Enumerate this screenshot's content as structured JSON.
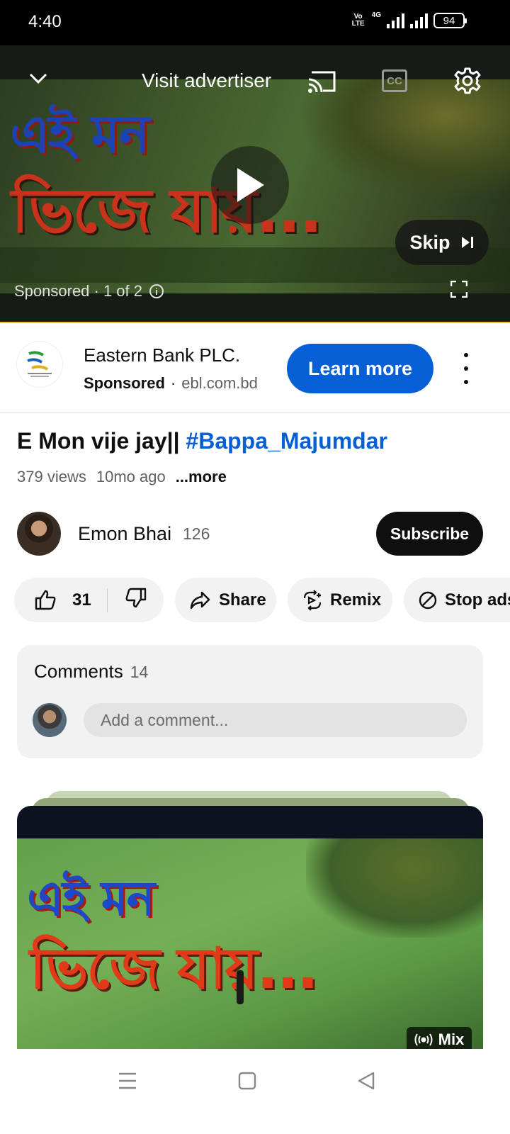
{
  "status_bar": {
    "time": "4:40",
    "volte": "Vo LTE",
    "network": "4G",
    "battery": "94"
  },
  "player": {
    "visit_advertiser": "Visit advertiser",
    "cc_label": "CC",
    "skip_label": "Skip",
    "sponsored_text": "Sponsored · 1 of 2",
    "thumbnail_line1": "এই মন",
    "thumbnail_line2": "ভিজে যায়...",
    "progress_color": "#f0c02a"
  },
  "ad": {
    "advertiser": "Eastern Bank PLC.",
    "sponsored_label": "Sponsored",
    "separator": "·",
    "domain": "ebl.com.bd",
    "cta": "Learn more",
    "cta_color": "#065fd4"
  },
  "video": {
    "title_plain": "E Mon vije jay|| ",
    "title_hashtag": "#Bappa_Majumdar",
    "views": "379 views",
    "age": "10mo ago",
    "more": "...more"
  },
  "channel": {
    "name": "Emon Bhai",
    "subscribers": "126",
    "subscribe_label": "Subscribe"
  },
  "actions": {
    "likes": "31",
    "share": "Share",
    "remix": "Remix",
    "stop_ads": "Stop ads"
  },
  "comments": {
    "heading": "Comments",
    "count": "14",
    "placeholder": "Add a comment..."
  },
  "next_video": {
    "thumbnail_line1": "এই মন",
    "thumbnail_line2": "ভিজে যায়...",
    "badge": "Mix"
  },
  "icons": {
    "chevron": "chevron-down-icon",
    "cast": "cast-icon",
    "settings": "gear-icon",
    "play": "play-icon",
    "fullscreen": "fullscreen-icon"
  }
}
